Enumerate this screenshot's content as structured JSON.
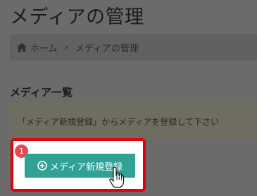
{
  "page": {
    "title": "メディアの管理"
  },
  "breadcrumb": {
    "home_icon": "home-icon",
    "home_label": "ホーム",
    "separator": "›",
    "current_label": "メディアの管理"
  },
  "section": {
    "heading": "メディア一覧"
  },
  "alert": {
    "message": "「メディア新規登録」からメディアを登録して下さい"
  },
  "annotation": {
    "step_number": "1",
    "frame_color": "#e3000f"
  },
  "register_button": {
    "icon": "plus-circle-icon",
    "label": "メディア新規登録",
    "color": "#2fa195"
  },
  "cursor": {
    "icon": "hand-pointer-icon"
  }
}
